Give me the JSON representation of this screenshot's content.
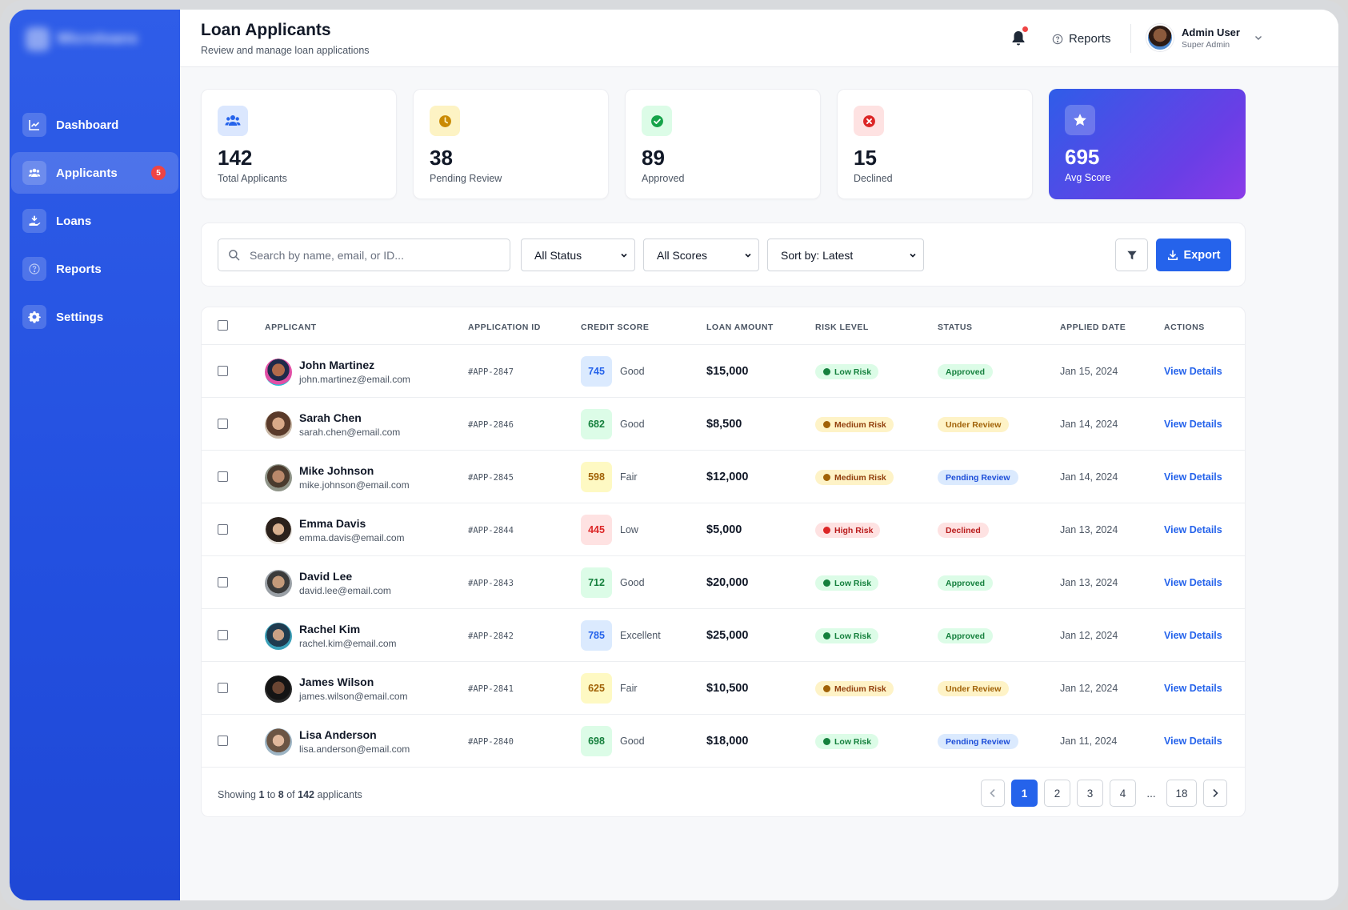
{
  "sidebar": {
    "brand": "Microloans",
    "items": [
      {
        "label": "Dashboard",
        "icon": "chart-line-icon"
      },
      {
        "label": "Applicants",
        "icon": "users-icon",
        "badge": "5",
        "active": true
      },
      {
        "label": "Loans",
        "icon": "hand-coin-icon"
      },
      {
        "label": "Reports",
        "icon": "help-circle-icon"
      },
      {
        "label": "Settings",
        "icon": "gear-icon"
      }
    ]
  },
  "header": {
    "title": "Loan Applicants",
    "subtitle": "Review and manage loan applications",
    "reports_label": "Reports",
    "user_name": "Admin User",
    "user_role": "Super Admin"
  },
  "stats": [
    {
      "value": "142",
      "label": "Total Applicants",
      "icon": "users-icon",
      "color": "#dbe7fe"
    },
    {
      "value": "38",
      "label": "Pending Review",
      "icon": "clock-icon",
      "color": "#fdf3c4"
    },
    {
      "value": "89",
      "label": "Approved",
      "icon": "check-circle-icon",
      "color": "#dcfce7"
    },
    {
      "value": "15",
      "label": "Declined",
      "icon": "x-circle-icon",
      "color": "#fee2e2"
    },
    {
      "value": "695",
      "label": "Avg Score",
      "icon": "star-icon",
      "color": "rgba(255,255,255,.22)"
    }
  ],
  "filters": {
    "search_placeholder": "Search by name, email, or ID...",
    "status": "All Status",
    "scores": "All Scores",
    "sort": "Sort by: Latest",
    "export_label": "Export"
  },
  "table": {
    "headers": [
      "APPLICANT",
      "APPLICATION ID",
      "CREDIT SCORE",
      "LOAN AMOUNT",
      "RISK LEVEL",
      "STATUS",
      "APPLIED DATE",
      "ACTIONS"
    ],
    "rows": [
      {
        "name": "John Martinez",
        "email": "john.martinez@email.com",
        "id": "#APP-2847",
        "score": "745",
        "score_label": "Good",
        "amount": "$15,000",
        "risk": "Low Risk",
        "status": "Approved",
        "date": "Jan 15, 2024",
        "action": "View Details"
      },
      {
        "name": "Sarah Chen",
        "email": "sarah.chen@email.com",
        "id": "#APP-2846",
        "score": "682",
        "score_label": "Good",
        "amount": "$8,500",
        "risk": "Medium Risk",
        "status": "Under Review",
        "date": "Jan 14, 2024",
        "action": "View Details"
      },
      {
        "name": "Mike Johnson",
        "email": "mike.johnson@email.com",
        "id": "#APP-2845",
        "score": "598",
        "score_label": "Fair",
        "amount": "$12,000",
        "risk": "Medium Risk",
        "status": "Pending Review",
        "date": "Jan 14, 2024",
        "action": "View Details"
      },
      {
        "name": "Emma Davis",
        "email": "emma.davis@email.com",
        "id": "#APP-2844",
        "score": "445",
        "score_label": "Low",
        "amount": "$5,000",
        "risk": "High Risk",
        "status": "Declined",
        "date": "Jan 13, 2024",
        "action": "View Details"
      },
      {
        "name": "David Lee",
        "email": "david.lee@email.com",
        "id": "#APP-2843",
        "score": "712",
        "score_label": "Good",
        "amount": "$20,000",
        "risk": "Low Risk",
        "status": "Approved",
        "date": "Jan 13, 2024",
        "action": "View Details"
      },
      {
        "name": "Rachel Kim",
        "email": "rachel.kim@email.com",
        "id": "#APP-2842",
        "score": "785",
        "score_label": "Excellent",
        "amount": "$25,000",
        "risk": "Low Risk",
        "status": "Approved",
        "date": "Jan 12, 2024",
        "action": "View Details"
      },
      {
        "name": "James Wilson",
        "email": "james.wilson@email.com",
        "id": "#APP-2841",
        "score": "625",
        "score_label": "Fair",
        "amount": "$10,500",
        "risk": "Medium Risk",
        "status": "Under Review",
        "date": "Jan 12, 2024",
        "action": "View Details"
      },
      {
        "name": "Lisa Anderson",
        "email": "lisa.anderson@email.com",
        "id": "#APP-2840",
        "score": "698",
        "score_label": "Good",
        "amount": "$18,000",
        "risk": "Low Risk",
        "status": "Pending Review",
        "date": "Jan 11, 2024",
        "action": "View Details"
      }
    ]
  },
  "pagination": {
    "showing_prefix": "Showing",
    "from": "1",
    "to_word": "to",
    "to": "8",
    "of_word": "of",
    "total": "142",
    "suffix": "applicants",
    "pages": [
      "1",
      "2",
      "3",
      "4",
      "...",
      "18"
    ],
    "current": "1"
  },
  "colors": {
    "accent": "#2563eb",
    "score_blue": "#dbeafe",
    "score_green": "#dcfce7",
    "score_yellow": "#fef9c3",
    "score_red": "#fee2e2"
  }
}
